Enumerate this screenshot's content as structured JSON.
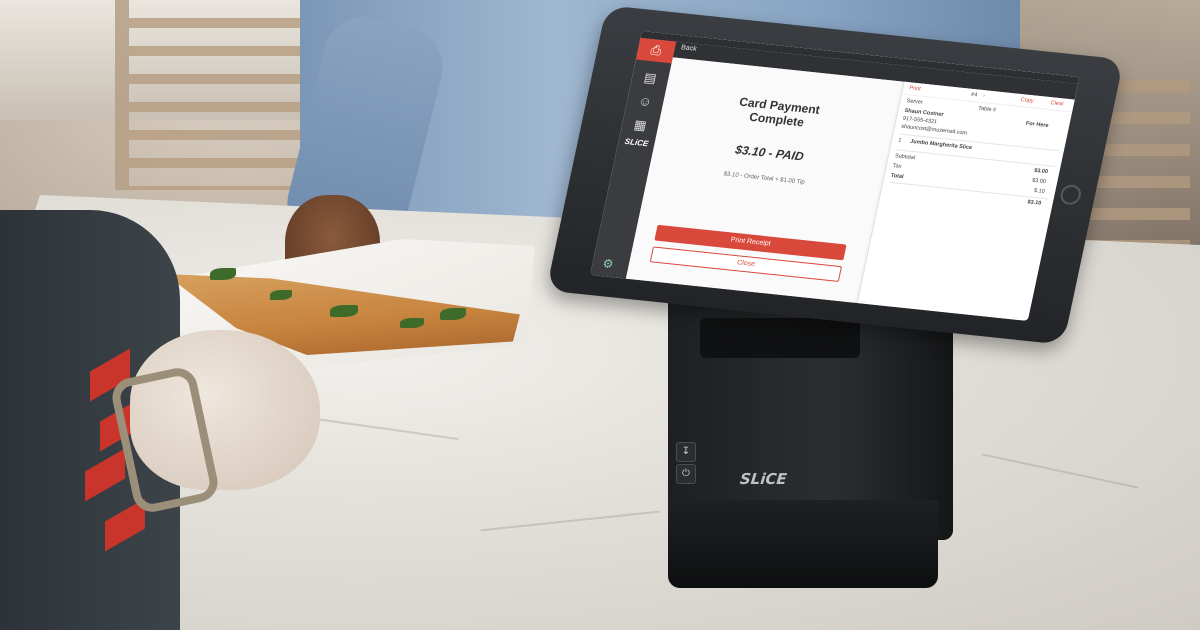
{
  "tablet": {
    "topbar": {
      "back_label": "Back"
    },
    "rail": {
      "logo": "SLiCE",
      "icons": [
        "printer-icon",
        "document-icon",
        "user-icon",
        "cash-icon",
        "gear-icon"
      ]
    },
    "payment": {
      "title_line1": "Card Payment",
      "title_line2": "Complete",
      "amount": "$3.10 - PAID",
      "detail": "$3.10 - Order Total + $1.00 Tip",
      "print_button": "Print Receipt",
      "close_button": "Close"
    },
    "order": {
      "header": {
        "print": "Print",
        "number": "#4",
        "copy": "Copy",
        "clear": "Clear"
      },
      "server_label": "Server",
      "table_label": "Table #",
      "customer_name": "Shaun Costner",
      "order_type": "For Here",
      "phone": "917-555-4321",
      "email": "shauncost@mozemail.com",
      "item_qty": "1",
      "item_name": "Jumbo Margherita Slice",
      "item_price": "$3.00",
      "subtotal_label": "Subtotal",
      "subtotal_value": "$3.00",
      "tax_label": "Tax",
      "tax_value": "$.10",
      "total_label": "Total",
      "total_value": "$3.10"
    }
  },
  "printer": {
    "brand": "SLiCE"
  },
  "colors": {
    "accent": "#d9493b",
    "rail": "#3a3c3f",
    "printer": "#1d1f21"
  }
}
